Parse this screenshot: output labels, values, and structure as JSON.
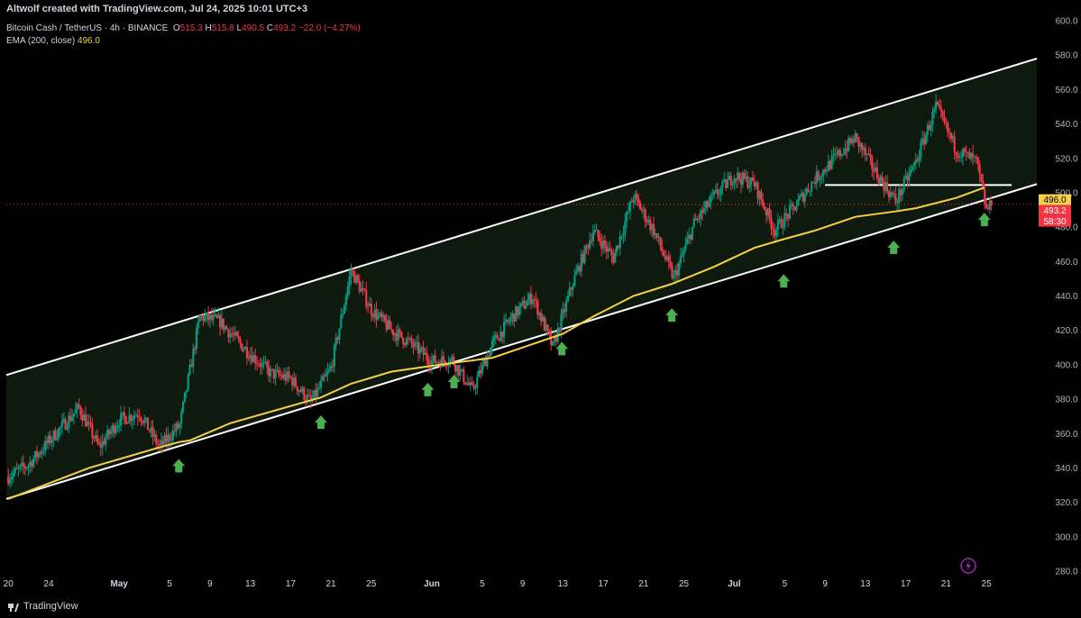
{
  "header": {
    "credit": "Altwolf created with TradingView.com, Jul 24, 2025 10:01 UTC+3",
    "symbol": "Bitcoin Cash / TetherUS · 4h · BINANCE",
    "o_label": "O",
    "o_value": "515.3",
    "h_label": "H",
    "h_value": "515.8",
    "l_label": "L",
    "l_value": "490.5",
    "c_label": "C",
    "c_value": "493.2",
    "change": "−22.0 (−4.27%)",
    "ema_label": "EMA (200, close)",
    "ema_value": "496.0"
  },
  "footer": {
    "brand": "TradingView"
  },
  "colors": {
    "background": "#000000",
    "up": "#089981",
    "down": "#f23645",
    "ema": "#f7d046",
    "channel_fill": "#0f1a0f",
    "channel_line": "#ffffff",
    "arrow": "#4caf50"
  },
  "chart_data": {
    "type": "candlestick",
    "ylim": [
      280,
      600
    ],
    "yticks": [
      "280.0",
      "300.0",
      "320.0",
      "340.0",
      "360.0",
      "380.0",
      "400.0",
      "420.0",
      "440.0",
      "460.0",
      "480.0",
      "500.0",
      "520.0",
      "540.0",
      "560.0",
      "580.0",
      "600.0"
    ],
    "xticks": [
      "20",
      "24",
      "May",
      "5",
      "9",
      "13",
      "17",
      "21",
      "25",
      "Jun",
      "5",
      "9",
      "13",
      "17",
      "21",
      "25",
      "Jul",
      "5",
      "9",
      "13",
      "17",
      "21",
      "25"
    ],
    "xtick_days": [
      0,
      4,
      11,
      16,
      20,
      24,
      28,
      32,
      36,
      42,
      47,
      51,
      55,
      59,
      63,
      67,
      72,
      77,
      81,
      85,
      89,
      93,
      97
    ],
    "x_range_days": [
      -0.2,
      102
    ],
    "price_tags": [
      {
        "text": "496.0",
        "value": 496.0,
        "bg": "#f7d046",
        "fg": "#000000"
      },
      {
        "text": "493.2",
        "value": 493.2,
        "bg": "#f23645",
        "fg": "#ffffff"
      },
      {
        "text": "58:30",
        "value": 487.6,
        "bg": "#f23645",
        "fg": "#ffffff"
      }
    ],
    "channel": {
      "upper": [
        [
          -0.2,
          394
        ],
        [
          102,
          578
        ]
      ],
      "lower": [
        [
          -0.2,
          322
        ],
        [
          102,
          505
        ]
      ]
    },
    "resistance": {
      "from_day": 81,
      "to_day": 99.5,
      "value": 504.5
    },
    "last_price_line": 493.2,
    "support_arrows_days": [
      16.9,
      31.0,
      41.6,
      44.2,
      54.9,
      65.8,
      76.9,
      87.8,
      96.8
    ],
    "price_path": [
      [
        0,
        335
      ],
      [
        2,
        342
      ],
      [
        5,
        362
      ],
      [
        7,
        375
      ],
      [
        9,
        352
      ],
      [
        11,
        368
      ],
      [
        13,
        372
      ],
      [
        15,
        352
      ],
      [
        17,
        365
      ],
      [
        19,
        428
      ],
      [
        21,
        425
      ],
      [
        23,
        412
      ],
      [
        26,
        395
      ],
      [
        28,
        392
      ],
      [
        30,
        378
      ],
      [
        32,
        398
      ],
      [
        34,
        455
      ],
      [
        36,
        432
      ],
      [
        38,
        420
      ],
      [
        40,
        412
      ],
      [
        42,
        402
      ],
      [
        44,
        403
      ],
      [
        46,
        385
      ],
      [
        48,
        412
      ],
      [
        50,
        428
      ],
      [
        52,
        440
      ],
      [
        54,
        410
      ],
      [
        56,
        448
      ],
      [
        58,
        478
      ],
      [
        60,
        462
      ],
      [
        62,
        498
      ],
      [
        64,
        478
      ],
      [
        66,
        450
      ],
      [
        68,
        482
      ],
      [
        70,
        498
      ],
      [
        72,
        510
      ],
      [
        74,
        505
      ],
      [
        76,
        478
      ],
      [
        78,
        492
      ],
      [
        80,
        508
      ],
      [
        82,
        520
      ],
      [
        84,
        532
      ],
      [
        86,
        512
      ],
      [
        88,
        495
      ],
      [
        90,
        518
      ],
      [
        92,
        550
      ],
      [
        94,
        525
      ],
      [
        96,
        518
      ],
      [
        97,
        490
      ],
      [
        97.6,
        493.2
      ]
    ],
    "ema": [
      [
        0,
        322
      ],
      [
        8,
        340
      ],
      [
        15,
        352
      ],
      [
        16.9,
        355
      ],
      [
        18,
        356
      ],
      [
        22,
        366
      ],
      [
        28,
        376
      ],
      [
        31,
        381
      ],
      [
        34,
        389
      ],
      [
        38,
        396
      ],
      [
        41.6,
        399
      ],
      [
        44,
        401
      ],
      [
        48,
        404
      ],
      [
        52,
        412
      ],
      [
        55,
        418
      ],
      [
        58,
        428
      ],
      [
        62,
        440
      ],
      [
        65.8,
        447
      ],
      [
        70,
        457
      ],
      [
        74,
        468
      ],
      [
        76.9,
        473
      ],
      [
        80,
        478
      ],
      [
        84,
        486
      ],
      [
        87.8,
        489
      ],
      [
        90,
        491
      ],
      [
        94,
        497
      ],
      [
        96.8,
        503
      ]
    ],
    "cursor_icon": "lightning-icon"
  }
}
